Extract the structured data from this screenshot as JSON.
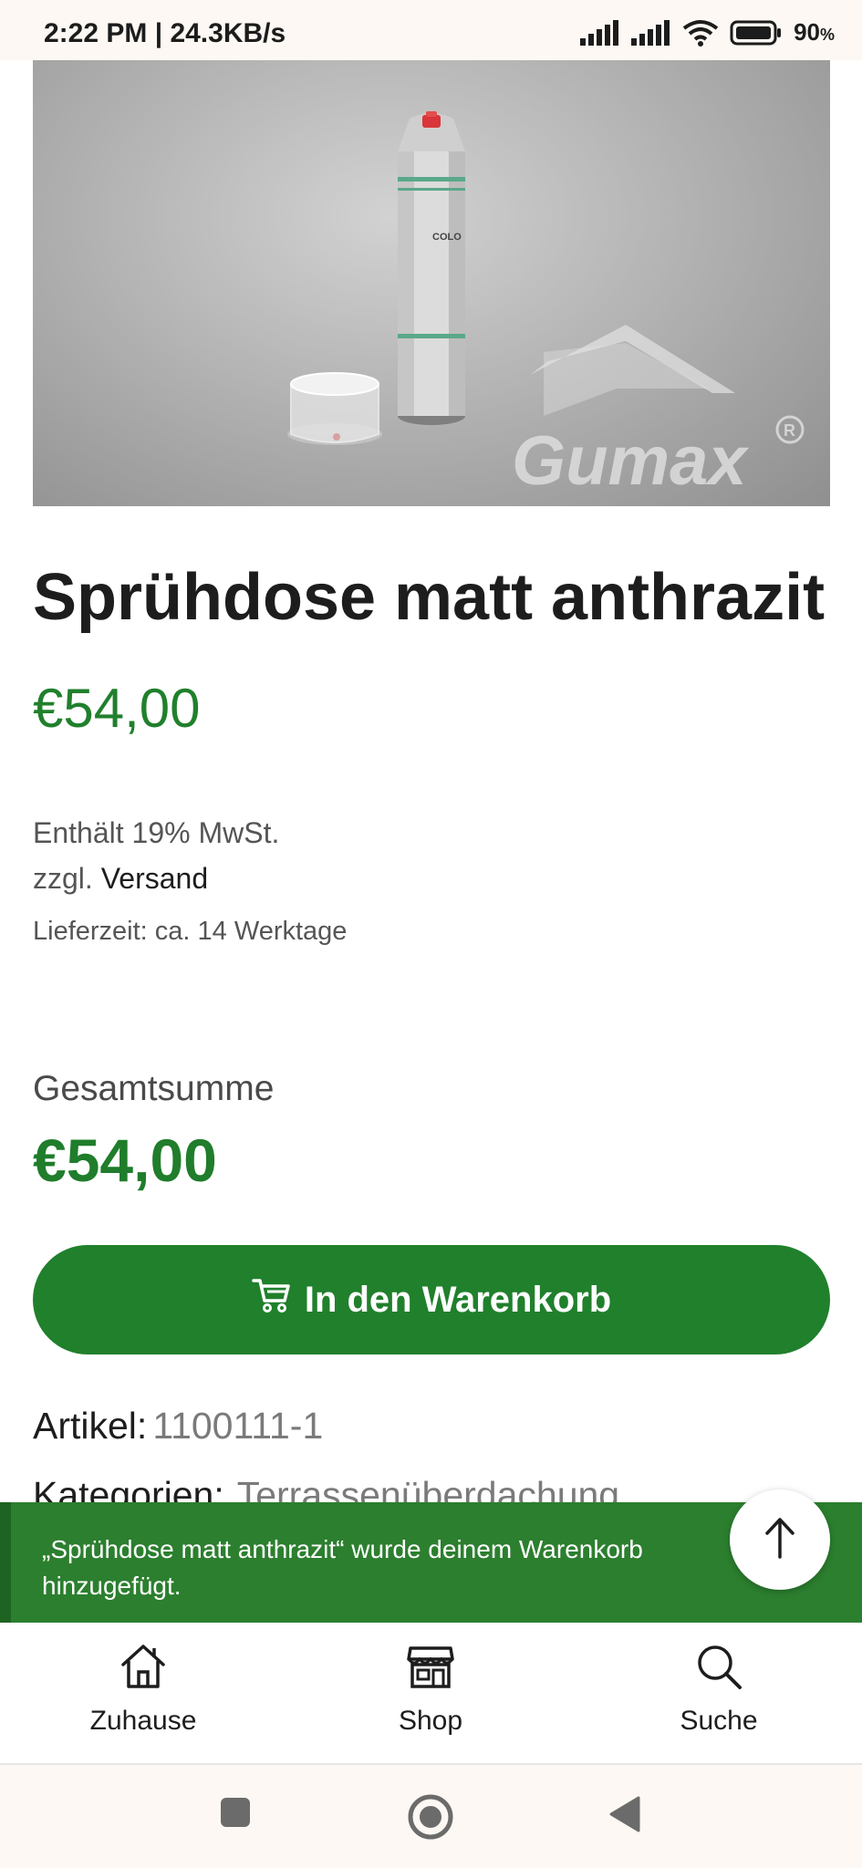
{
  "status_bar": {
    "left_text": "2:22 PM | 24.3KB/s",
    "battery_percent": "90",
    "battery_unit": "%",
    "icons": [
      "signal-icon",
      "signal-icon",
      "wifi-icon",
      "battery-icon"
    ]
  },
  "product": {
    "image_brand": "Gumax",
    "title": "Sprühdose matt anthrazit",
    "price": "€54,00",
    "tax_note": "Enthält 19% MwSt.",
    "shipping_prefix": "zzgl.",
    "shipping_link": "Versand",
    "delivery_time": "Lieferzeit: ca. 14 Werktage"
  },
  "total": {
    "label": "Gesamtsumme",
    "value": "€54,00"
  },
  "cart_button": {
    "label": "In den Warenkorb",
    "icon": "cart-icon"
  },
  "meta": {
    "sku_label": "Artikel:",
    "sku_value": "1100111-1",
    "category_label": "Kategorien:",
    "category_value": "Terrassenüberdachung"
  },
  "notice": {
    "text": "„Sprühdose matt anthrazit“ wurde deinem Warenkorb hinzugefügt."
  },
  "bottom_nav": {
    "items": [
      {
        "label": "Zuhause",
        "icon": "home-icon"
      },
      {
        "label": "Shop",
        "icon": "shop-icon"
      },
      {
        "label": "Suche",
        "icon": "search-icon"
      }
    ]
  },
  "colors": {
    "accent_green": "#20802c",
    "notice_green": "#2c7f2f"
  }
}
